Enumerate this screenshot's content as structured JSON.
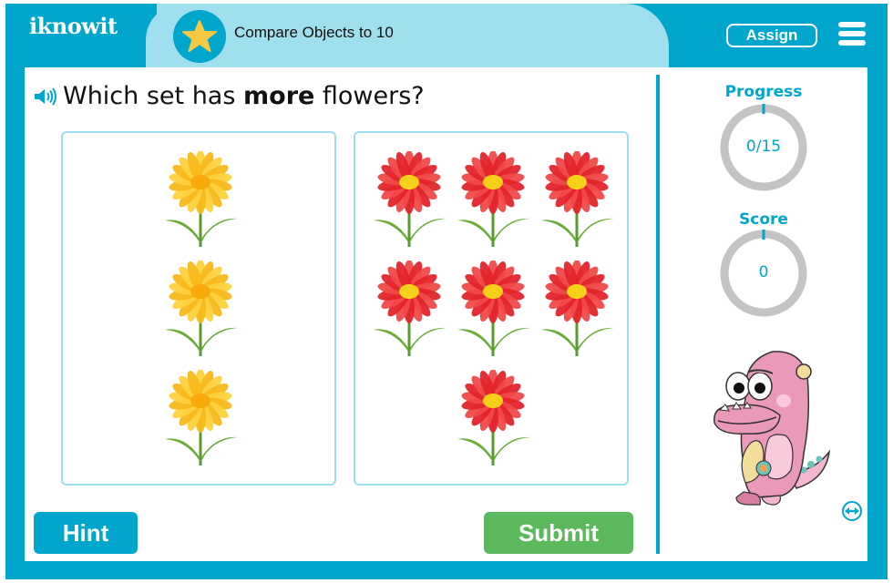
{
  "app": {
    "logo_text": "iknowit",
    "lesson_title": "Compare Objects to 10",
    "assign_label": "Assign",
    "icons": {
      "badge": "star-icon",
      "menu": "hamburger-menu-icon",
      "audio": "speaker-icon",
      "expand": "expand-arrows-icon"
    }
  },
  "question": {
    "prefix": "Which set has ",
    "emphasis": "more",
    "suffix": " flowers?"
  },
  "choices": [
    {
      "id": "left-set",
      "flower_color": "yellow",
      "count": 3
    },
    {
      "id": "right-set",
      "flower_color": "red",
      "count": 7
    }
  ],
  "buttons": {
    "hint": "Hint",
    "submit": "Submit"
  },
  "sidebar": {
    "progress_label": "Progress",
    "progress_value": "0/15",
    "progress_fraction": 0,
    "score_label": "Score",
    "score_value": "0",
    "score_fraction": 0
  },
  "colors": {
    "brand": "#00a6cc",
    "title_band": "#9fdfee",
    "submit": "#5cb85c",
    "card_border": "#9ddff0",
    "ring_track": "#c4c4c4",
    "star": "#f6c945"
  }
}
